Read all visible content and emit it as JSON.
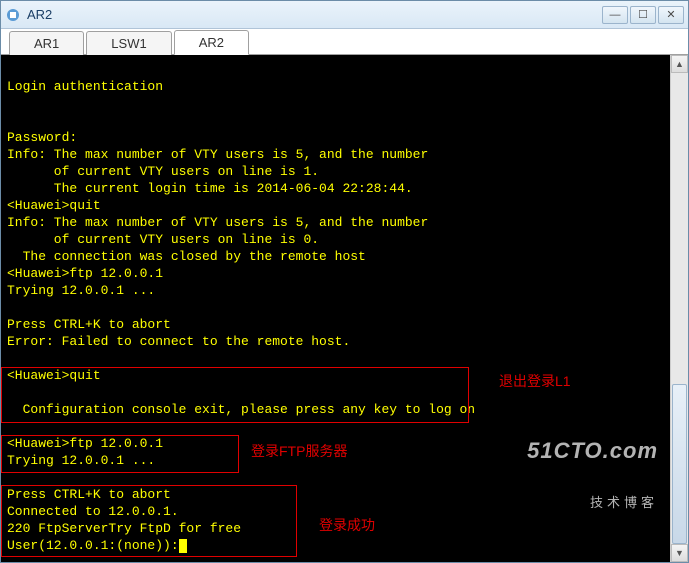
{
  "window": {
    "title": "AR2"
  },
  "tabs": [
    {
      "label": "AR1",
      "active": false
    },
    {
      "label": "LSW1",
      "active": false
    },
    {
      "label": "AR2",
      "active": true
    }
  ],
  "terminal": {
    "lines": [
      "",
      "Login authentication",
      "",
      "",
      "Password:",
      "Info: The max number of VTY users is 5, and the number",
      "      of current VTY users on line is 1.",
      "      The current login time is 2014-06-04 22:28:44.",
      "<Huawei>quit",
      "Info: The max number of VTY users is 5, and the number",
      "      of current VTY users on line is 0.",
      "  The connection was closed by the remote host",
      "<Huawei>ftp 12.0.0.1",
      "Trying 12.0.0.1 ...",
      "",
      "Press CTRL+K to abort",
      "Error: Failed to connect to the remote host.",
      "",
      "<Huawei>quit",
      "",
      "  Configuration console exit, please press any key to log on",
      "",
      "<Huawei>ftp 12.0.0.1",
      "Trying 12.0.0.1 ...",
      "",
      "Press CTRL+K to abort",
      "Connected to 12.0.0.1.",
      "220 FtpServerTry FtpD for free",
      "User(12.0.0.1:(none)):"
    ]
  },
  "annotations": {
    "a1": "退出登录L1",
    "a2": "登录FTP服务器",
    "a3": "登录成功"
  },
  "watermark": {
    "main": "51CTO.com",
    "sub": "技术博客"
  }
}
